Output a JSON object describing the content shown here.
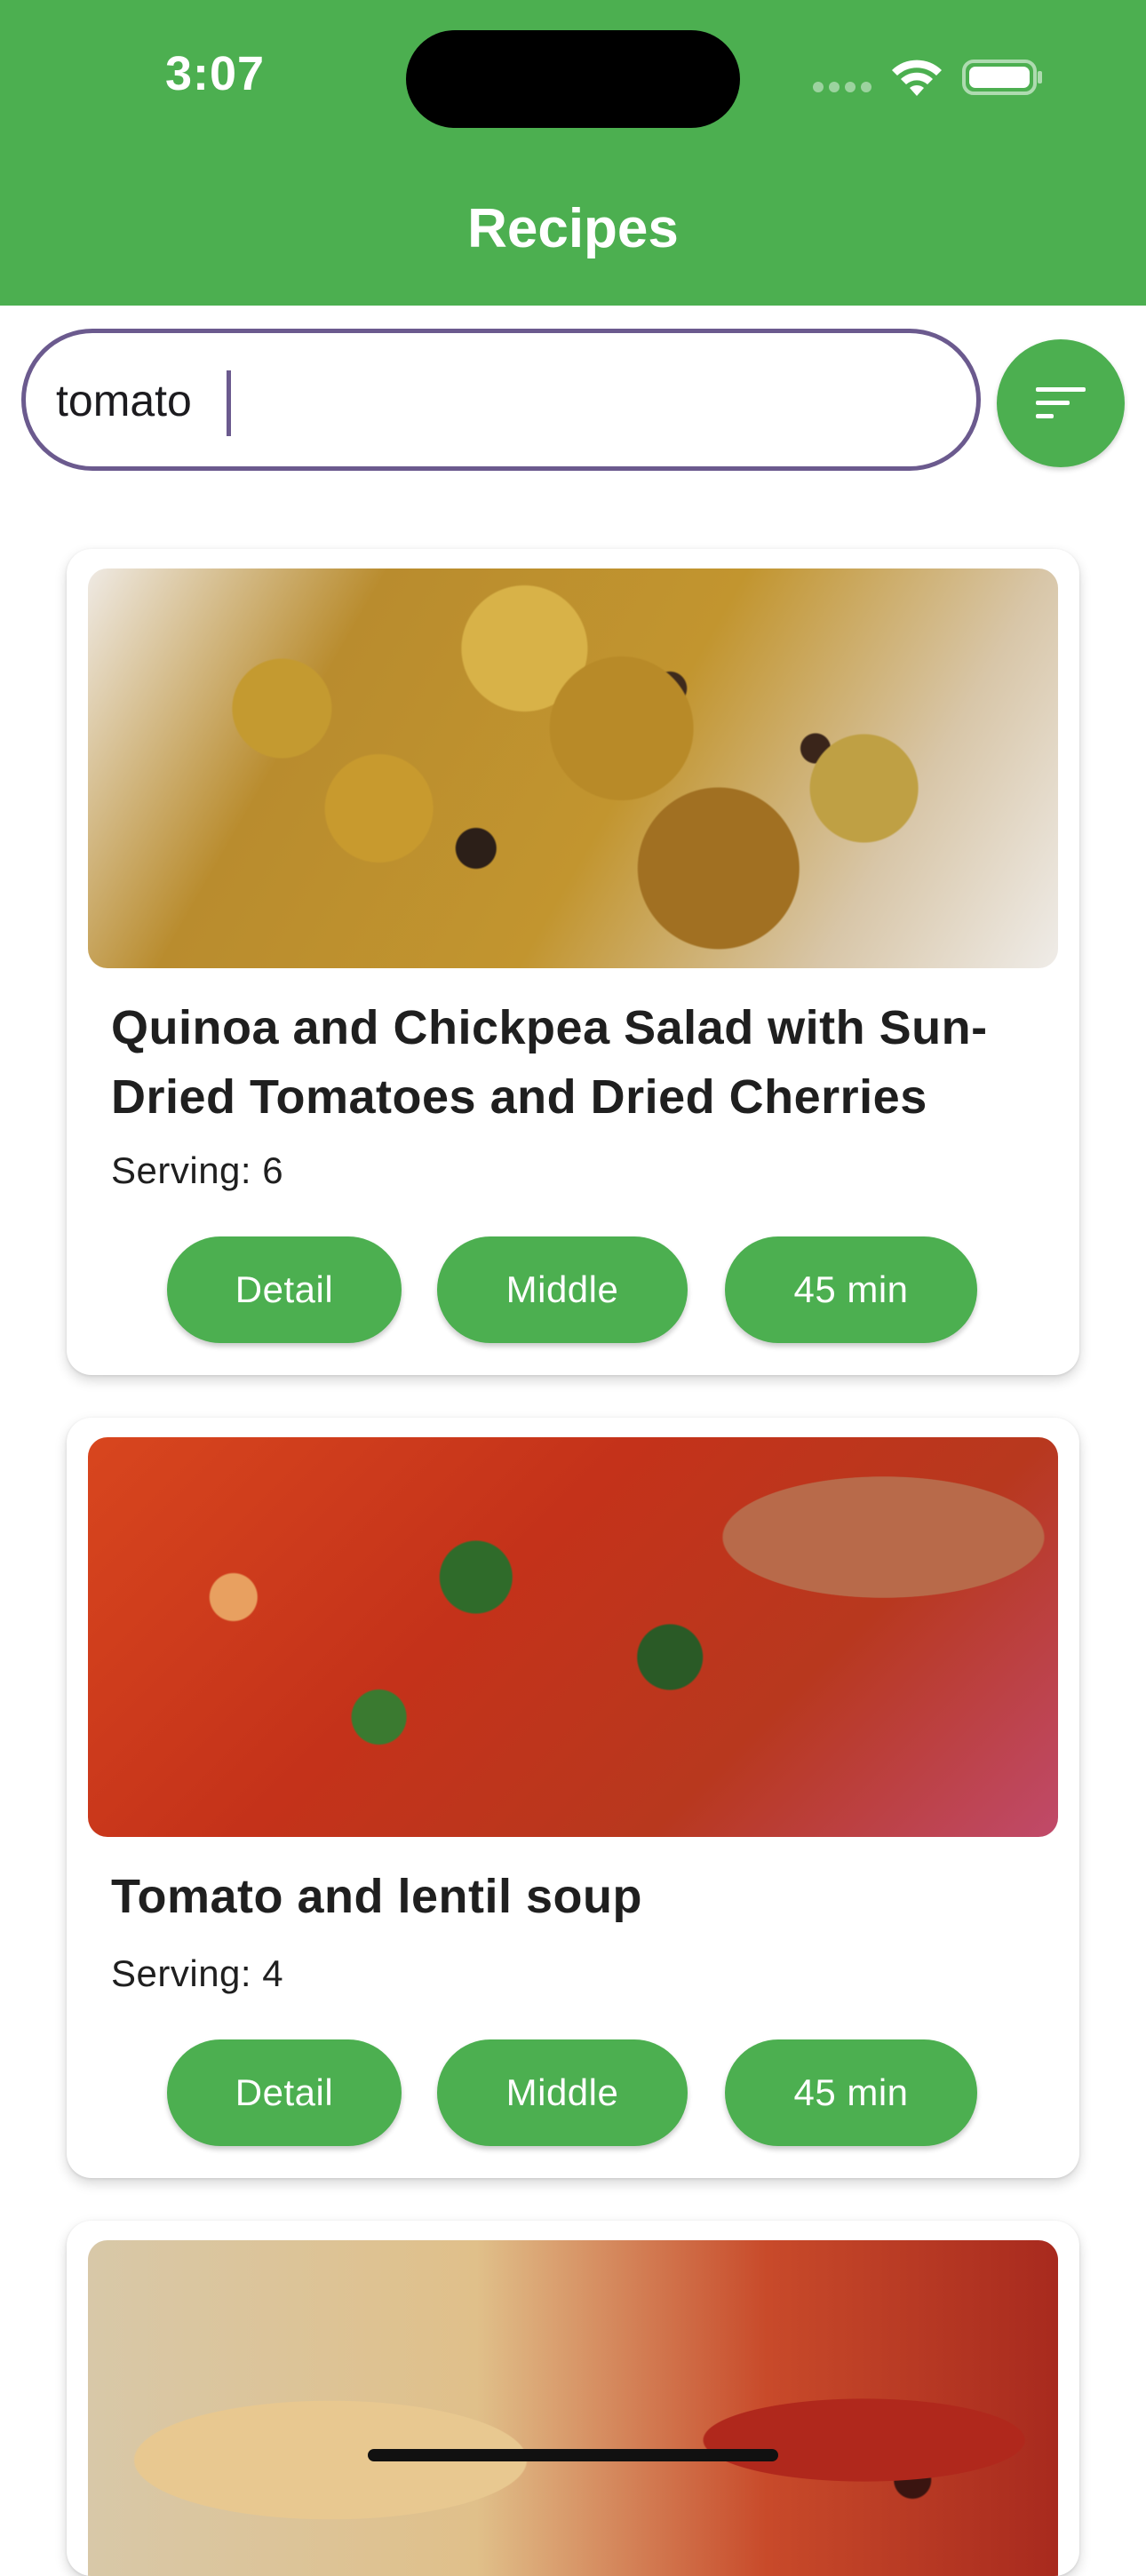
{
  "status_bar": {
    "time": "3:07"
  },
  "header": {
    "title": "Recipes",
    "background_color": "#4CAF50"
  },
  "search": {
    "value": "tomato",
    "placeholder": "",
    "border_color": "#6b5a8e"
  },
  "filter_button": {
    "icon": "sort-icon"
  },
  "recipes": [
    {
      "title": "Quinoa and Chickpea Salad with Sun-Dried Tomatoes and Dried Cherries",
      "serving": "Serving: 6",
      "detail_label": "Detail",
      "level_label": "Middle",
      "time_label": "45 min"
    },
    {
      "title": "Tomato and lentil soup",
      "serving": "Serving: 4",
      "detail_label": "Detail",
      "level_label": "Middle",
      "time_label": "45 min"
    },
    {
      "title": "",
      "serving": ""
    }
  ],
  "accent_color": "#4CAF50"
}
